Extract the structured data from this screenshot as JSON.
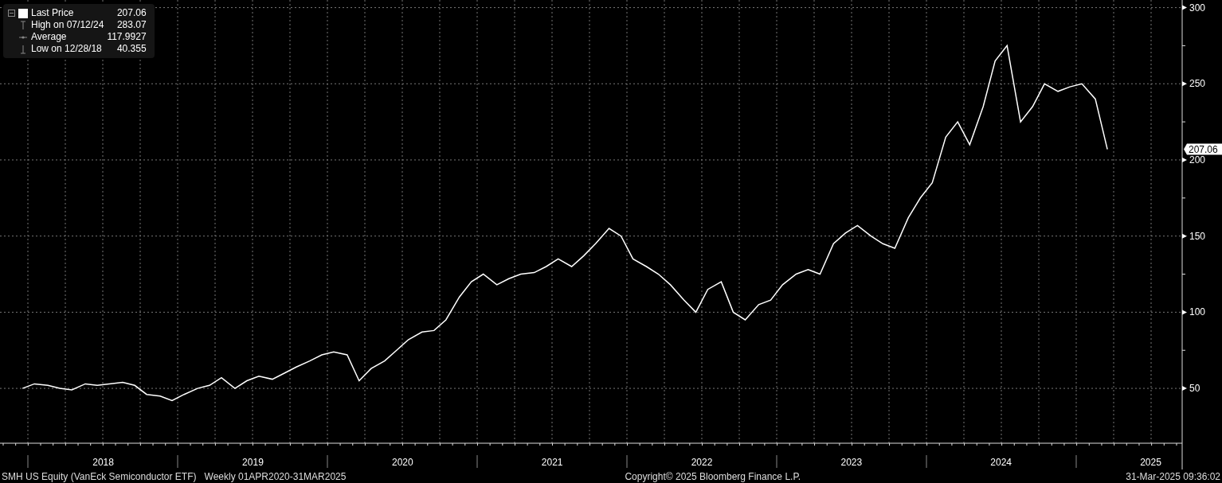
{
  "legend": {
    "rows": [
      {
        "kind": "last",
        "value": "207.06"
      },
      {
        "kind": "high",
        "label": "High on 07/12/24",
        "value": "283.07"
      },
      {
        "kind": "average",
        "label": "Average",
        "value": "117.9927"
      },
      {
        "kind": "low",
        "label": "Low on 12/28/18",
        "value": "40.355"
      }
    ]
  },
  "last_price_tag": "207.06",
  "chart_data": {
    "type": "line",
    "grid": true,
    "xlim": [
      2017.81,
      2025.71
    ],
    "x": [
      2017.96,
      2018.04,
      2018.13,
      2018.21,
      2018.29,
      2018.38,
      2018.46,
      2018.54,
      2018.63,
      2018.71,
      2018.79,
      2018.88,
      2018.96,
      2019.04,
      2019.13,
      2019.21,
      2019.29,
      2019.38,
      2019.46,
      2019.54,
      2019.63,
      2019.71,
      2019.79,
      2019.88,
      2019.96,
      2020.04,
      2020.13,
      2020.21,
      2020.29,
      2020.38,
      2020.46,
      2020.54,
      2020.63,
      2020.71,
      2020.79,
      2020.88,
      2020.96,
      2021.04,
      2021.13,
      2021.21,
      2021.29,
      2021.38,
      2021.46,
      2021.54,
      2021.63,
      2021.71,
      2021.79,
      2021.88,
      2021.96,
      2022.04,
      2022.13,
      2022.21,
      2022.29,
      2022.38,
      2022.46,
      2022.54,
      2022.63,
      2022.71,
      2022.79,
      2022.88,
      2022.96,
      2023.04,
      2023.13,
      2023.21,
      2023.29,
      2023.38,
      2023.46,
      2023.54,
      2023.63,
      2023.71,
      2023.79,
      2023.88,
      2023.96,
      2024.04,
      2024.13,
      2024.21,
      2024.29,
      2024.38,
      2024.46,
      2024.54,
      2024.63,
      2024.71,
      2024.79,
      2024.88,
      2024.96,
      2025.04,
      2025.13,
      2025.21
    ],
    "series": [
      {
        "name": "Last Price",
        "color": "#ffffff",
        "values": [
          50,
          53,
          52,
          50,
          49,
          53,
          52,
          53,
          54,
          52,
          46,
          45,
          42,
          46,
          50,
          52,
          57,
          50,
          55,
          58,
          56,
          60,
          64,
          68,
          72,
          74,
          72,
          55,
          63,
          68,
          75,
          82,
          87,
          88,
          95,
          110,
          120,
          125,
          118,
          122,
          125,
          126,
          130,
          135,
          130,
          137,
          145,
          155,
          150,
          135,
          130,
          125,
          118,
          108,
          100,
          115,
          120,
          100,
          95,
          105,
          108,
          118,
          125,
          128,
          125,
          145,
          152,
          157,
          150,
          145,
          142,
          162,
          175,
          185,
          215,
          225,
          210,
          235,
          265,
          275,
          225,
          235,
          250,
          245,
          248,
          250,
          240,
          207
        ]
      }
    ],
    "ylim": [
      14,
      305
    ],
    "yticks": [
      50,
      100,
      150,
      200,
      250,
      300
    ],
    "xticks": [
      {
        "value": 2018.5,
        "label": "2018"
      },
      {
        "value": 2019.5,
        "label": "2019"
      },
      {
        "value": 2020.5,
        "label": "2020"
      },
      {
        "value": 2021.5,
        "label": "2021"
      },
      {
        "value": 2022.5,
        "label": "2022"
      },
      {
        "value": 2023.5,
        "label": "2023"
      },
      {
        "value": 2024.5,
        "label": "2024"
      },
      {
        "value": 2025.5,
        "label": "2025"
      }
    ]
  },
  "status_bar": {
    "security": "SMH US Equity (VanEck Semiconductor ETF)",
    "period": "Weekly 01APR2020-31MAR2025",
    "copyright": "Copyright© 2025 Bloomberg Finance L.P.",
    "timestamp": "31-Mar-2025 09:36:02"
  }
}
